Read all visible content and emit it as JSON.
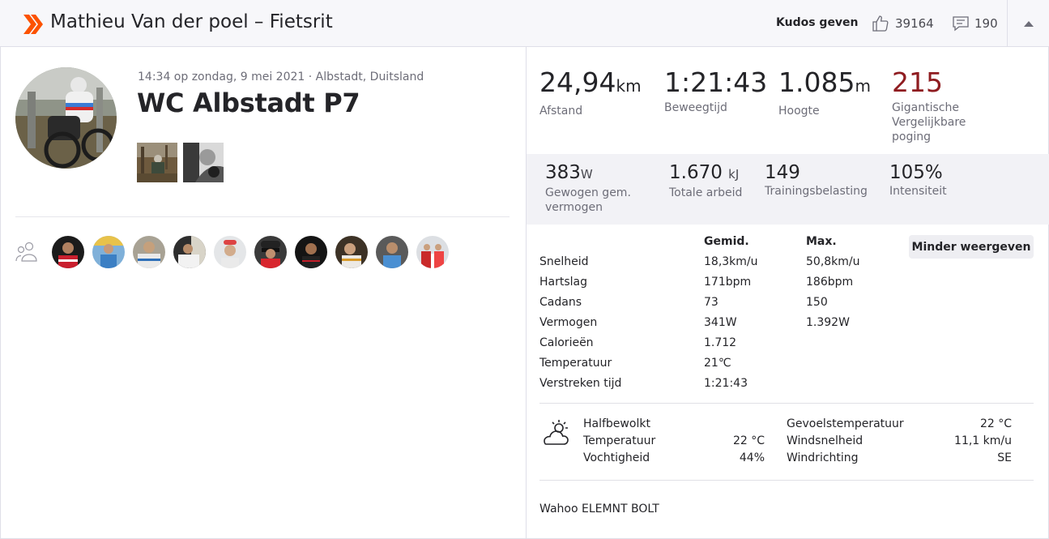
{
  "header": {
    "title": "Mathieu Van der poel – Fietsrit",
    "kudos_label": "Kudos geven",
    "kudos_count": "39164",
    "comment_count": "190",
    "brand_color": "#fc5200"
  },
  "activity": {
    "meta": "14:34 op zondag, 9 mei 2021 · Albstadt, Duitsland",
    "title": "WC Albstadt P7"
  },
  "primary_stats": [
    {
      "value": "24,94",
      "unit": "km",
      "label": "Afstand"
    },
    {
      "value": "1:21:43",
      "unit": "",
      "label": "Beweegtijd"
    },
    {
      "value": "1.085",
      "unit": "m",
      "label": "Hoogte"
    },
    {
      "value": "215",
      "unit": "",
      "label": "Gigantische Vergelijkbare poging",
      "color": "#8f1c20"
    }
  ],
  "secondary_stats": [
    {
      "value": "383",
      "unit": "W",
      "label": "Gewogen gem. vermogen"
    },
    {
      "value": "1.670",
      "unit": "kJ",
      "label": "Totale arbeid"
    },
    {
      "value": "149",
      "unit": "",
      "label": "Trainingsbelasting"
    },
    {
      "value": "105%",
      "unit": "",
      "label": "Intensiteit"
    }
  ],
  "details": {
    "avg_header": "Gemid.",
    "max_header": "Max.",
    "toggle_label": "Minder weergeven",
    "rows": [
      {
        "label": "Snelheid",
        "avg": "18,3km/u",
        "max": "50,8km/u"
      },
      {
        "label": "Hartslag",
        "avg": "171bpm",
        "max": "186bpm"
      },
      {
        "label": "Cadans",
        "avg": "73",
        "max": "150"
      },
      {
        "label": "Vermogen",
        "avg": "341W",
        "max": "1.392W"
      },
      {
        "label": "Calorieën",
        "avg": "1.712",
        "max": ""
      },
      {
        "label": "Temperatuur",
        "avg": "21℃",
        "max": ""
      },
      {
        "label": "Verstreken tijd",
        "avg": "1:21:43",
        "max": ""
      }
    ]
  },
  "weather": {
    "icon": "partly-cloudy-icon",
    "condition": "Halfbewolkt",
    "temp_label": "Temperatuur",
    "temp_value": "22 °C",
    "humidity_label": "Vochtigheid",
    "humidity_value": "44%",
    "feels_label": "Gevoelstemperatuur",
    "feels_value": "22 °C",
    "wind_speed_label": "Windsnelheid",
    "wind_speed_value": "11,1 km/u",
    "wind_dir_label": "Windrichting",
    "wind_dir_value": "SE"
  },
  "device": "Wahoo ELEMNT BOLT"
}
